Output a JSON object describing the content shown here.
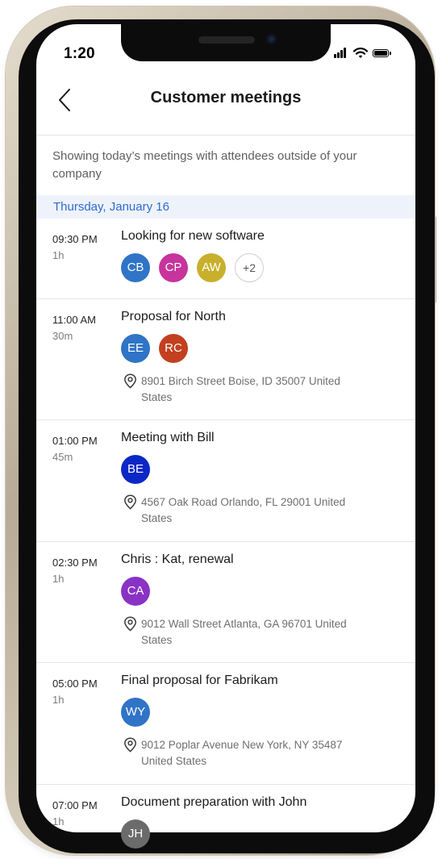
{
  "status_bar": {
    "time": "1:20"
  },
  "header": {
    "title": "Customer meetings"
  },
  "subtitle": "Showing today’s meetings with attendees outside of your company",
  "date_label": "Thursday, January 16",
  "meetings": [
    {
      "time": "09:30 PM",
      "duration": "1h",
      "title": "Looking for new software",
      "attendees": [
        {
          "initials": "CB",
          "color": "#2f74c6"
        },
        {
          "initials": "CP",
          "color": "#c6349c"
        },
        {
          "initials": "AW",
          "color": "#c9b02c"
        }
      ],
      "more": "+2"
    },
    {
      "time": "11:00 AM",
      "duration": "30m",
      "title": "Proposal for North",
      "attendees": [
        {
          "initials": "EE",
          "color": "#2f74c6"
        },
        {
          "initials": "RC",
          "color": "#c2401f"
        }
      ],
      "location": "8901 Birch Street Boise, ID 35007 United States"
    },
    {
      "time": "01:00 PM",
      "duration": "45m",
      "title": "Meeting with Bill",
      "attendees": [
        {
          "initials": "BE",
          "color": "#0b27c6"
        }
      ],
      "location": "4567 Oak Road Orlando, FL 29001 United States"
    },
    {
      "time": "02:30 PM",
      "duration": "1h",
      "title": "Chris : Kat, renewal",
      "attendees": [
        {
          "initials": "CA",
          "color": "#8a32c4"
        }
      ],
      "location": "9012 Wall Street Atlanta, GA 96701 United States"
    },
    {
      "time": "05:00 PM",
      "duration": "1h",
      "title": "Final proposal for Fabrikam",
      "attendees": [
        {
          "initials": "WY",
          "color": "#2f74c6"
        }
      ],
      "location": "9012 Poplar Avenue New York, NY 35487 United States"
    },
    {
      "time": "07:00 PM",
      "duration": "1h",
      "title": "Document preparation with John",
      "attendees": [
        {
          "initials": "JH",
          "color": "#6b6b6b"
        }
      ]
    }
  ]
}
